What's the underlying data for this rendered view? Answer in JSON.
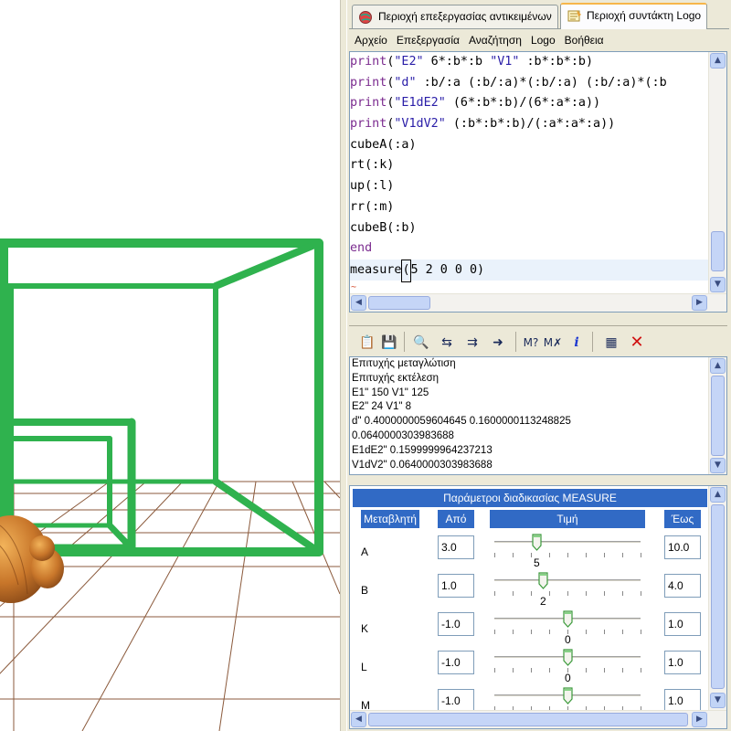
{
  "tabs": {
    "objects": "Περιοχή επεξεργασίας αντικειμένων",
    "editor": "Περιοχή συντάκτη Logo"
  },
  "menu": [
    "Αρχείο",
    "Επεξεργασία",
    "Αναζήτηση",
    "Logo",
    "Βοήθεια"
  ],
  "code": {
    "lines": [
      {
        "kw": "print",
        "rest": "(\"E2\" 6*:b*:b \"V1\" :b*:b*:b)"
      },
      {
        "kw": "print",
        "rest": "(\"d\" :b/:a (:b/:a)*(:b/:a) (:b/:a)*(:b"
      },
      {
        "kw": "print",
        "rest": "(\"E1dE2\" (6*:b*:b)/(6*:a*:a))"
      },
      {
        "kw": "print",
        "rest": "(\"V1dV2\" (:b*:b*:b)/(:a*:a*:a))"
      },
      {
        "kw": "",
        "rest": "cubeA(:a)"
      },
      {
        "kw": "",
        "rest": "rt(:k)"
      },
      {
        "kw": "",
        "rest": "up(:l)"
      },
      {
        "kw": "",
        "rest": "rr(:m)"
      },
      {
        "kw": "",
        "rest": "cubeB(:b)"
      },
      {
        "kw": "end",
        "rest": ""
      },
      {
        "kw": "",
        "rest": "measure(5 2 0 0 0)"
      }
    ],
    "tilde": "~"
  },
  "output": {
    "lines": [
      "Επιτυχής μεταγλώτιση",
      "Επιτυχής εκτέλεση",
      "E1\" 150 V1\" 125",
      "E2\" 24 V1\" 8",
      "d\" 0.4000000059604645 0.1600000113248825",
      "0.0640000303983688",
      "E1dE2\" 0.1599999964237213",
      "V1dV2\" 0.0640000303983688"
    ]
  },
  "measure": {
    "title": "Παράμετροι διαδικασίας MEASURE",
    "headers": {
      "variable": "Μεταβλητή",
      "from": "Από",
      "value": "Τιμή",
      "to": "Έως"
    },
    "rows": [
      {
        "name": "A",
        "from": "3.0",
        "value": "5",
        "to": "10.0",
        "fraction": 0.29
      },
      {
        "name": "B",
        "from": "1.0",
        "value": "2",
        "to": "4.0",
        "fraction": 0.33
      },
      {
        "name": "K",
        "from": "-1.0",
        "value": "0",
        "to": "1.0",
        "fraction": 0.5
      },
      {
        "name": "L",
        "from": "-1.0",
        "value": "0",
        "to": "1.0",
        "fraction": 0.5
      },
      {
        "name": "M",
        "from": "-1.0",
        "value": "0",
        "to": "1.0",
        "fraction": 0.5
      }
    ]
  },
  "colors": {
    "cube": "#2fb24e",
    "accent": "#316ac5",
    "keyword": "#7b2b8f",
    "string": "#2a1ea8"
  }
}
